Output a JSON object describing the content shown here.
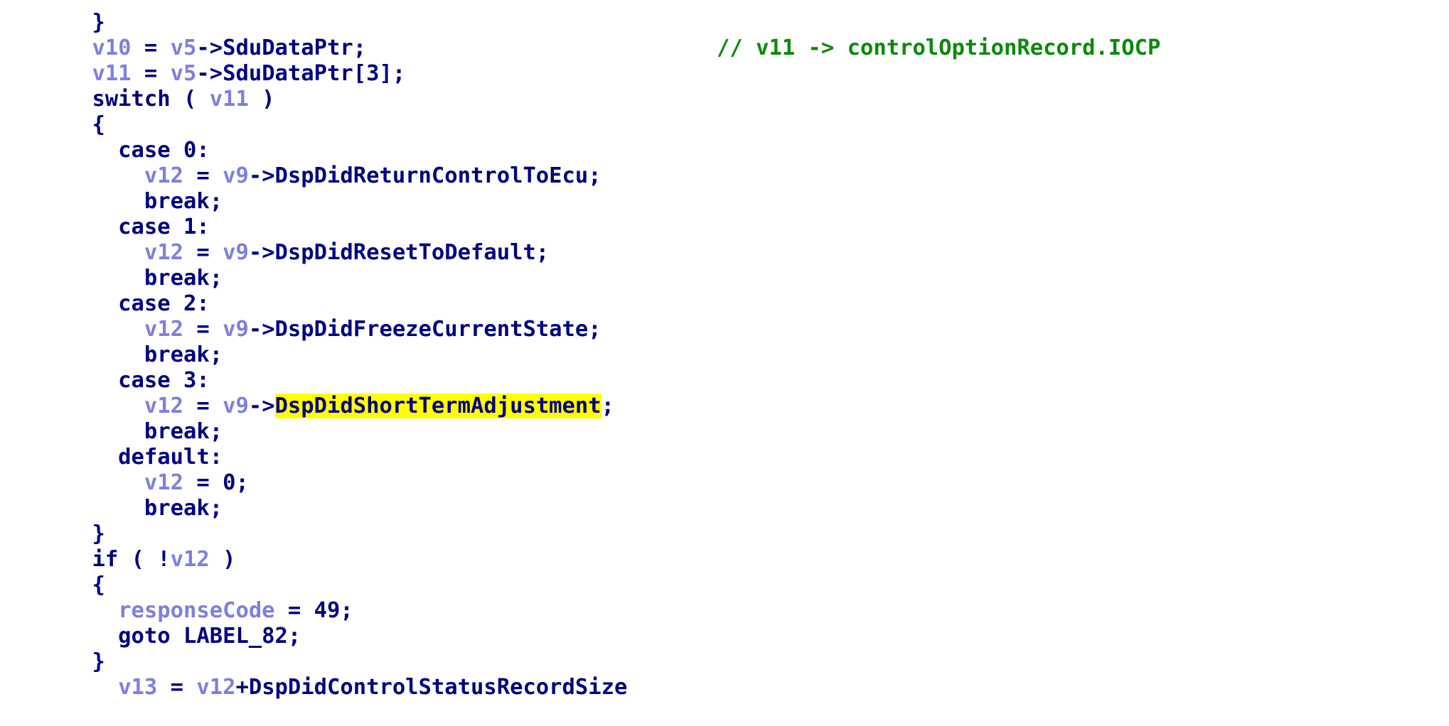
{
  "lines": [
    {
      "text": "}"
    },
    {
      "parts": [
        "v10",
        " = ",
        "v5",
        "->SduDataPtr;"
      ]
    },
    {
      "parts": [
        "v11",
        " = ",
        "v5",
        "->SduDataPtr[3];"
      ],
      "comment": "// v11 -> controlOptionRecord.IOCP"
    },
    {
      "parts": [
        "switch ( ",
        "v11",
        " )"
      ]
    },
    {
      "text": "{"
    },
    {
      "text": "  case 0:"
    },
    {
      "parts": [
        "    ",
        "v12",
        " = ",
        "v9",
        "->DspDidReturnControlToEcu;"
      ]
    },
    {
      "text": "    break;"
    },
    {
      "text": "  case 1:"
    },
    {
      "parts": [
        "    ",
        "v12",
        " = ",
        "v9",
        "->DspDidResetToDefault;"
      ]
    },
    {
      "text": "    break;"
    },
    {
      "text": "  case 2:"
    },
    {
      "parts": [
        "    ",
        "v12",
        " = ",
        "v9",
        "->DspDidFreezeCurrentState;"
      ]
    },
    {
      "text": "    break;"
    },
    {
      "text": "  case 3:"
    },
    {
      "parts": [
        "    ",
        "v12",
        " = ",
        "v9",
        "->",
        "DspDidShortTermAdjustment",
        ";"
      ]
    },
    {
      "text": "    break;"
    },
    {
      "text": "  default:"
    },
    {
      "parts": [
        "    ",
        "v12",
        " = 0;"
      ]
    },
    {
      "text": "    break;"
    },
    {
      "text": "}"
    },
    {
      "parts": [
        "if ( !",
        "v12",
        " )"
      ]
    },
    {
      "text": "{"
    },
    {
      "parts": [
        "  ",
        "responseCode",
        " = 49;"
      ]
    },
    {
      "text": "  goto LABEL_82;"
    },
    {
      "text": "}"
    },
    {
      "parts": [
        "  ",
        "v13",
        " = ",
        "v12",
        "+DspDidControlStatusRecordSize"
      ]
    }
  ],
  "colors": {
    "keyword": "#000080",
    "variable": "#7f7fe0",
    "comment": "#0a8a0a",
    "highlight": "#ffff00"
  }
}
